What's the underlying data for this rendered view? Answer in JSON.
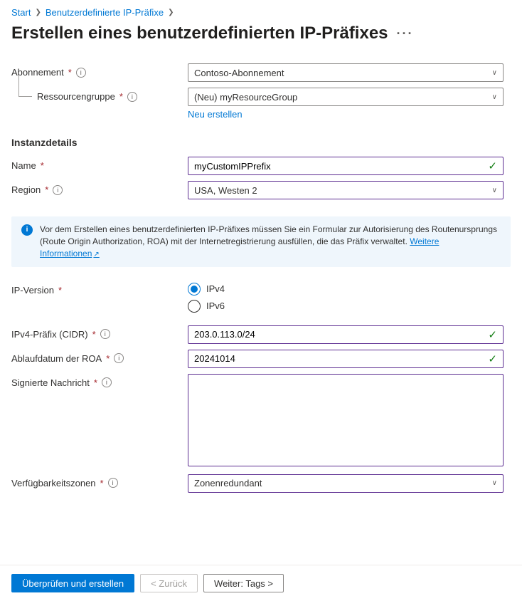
{
  "breadcrumb": {
    "items": [
      "Start",
      "Benutzerdefinierte IP-Präfixe"
    ]
  },
  "page": {
    "title": "Erstellen eines benutzerdefinierten IP-Präfixes"
  },
  "subscription": {
    "label": "Abonnement",
    "value": "Contoso-Abonnement"
  },
  "resourceGroup": {
    "label": "Ressourcengruppe",
    "value": "(Neu) myResourceGroup",
    "createNew": "Neu erstellen"
  },
  "instanceDetails": {
    "header": "Instanzdetails"
  },
  "name": {
    "label": "Name",
    "value": "myCustomIPPrefix"
  },
  "region": {
    "label": "Region",
    "value": "USA, Westen 2"
  },
  "infoBanner": {
    "text": "Vor dem Erstellen eines benutzerdefinierten IP-Präfixes müssen Sie ein Formular zur Autorisierung des Routenursprungs (Route Origin Authorization, ROA) mit der Internetregistrierung ausfüllen, die das Präfix verwaltet. ",
    "link": "Weitere Informationen"
  },
  "ipVersion": {
    "label": "IP-Version",
    "options": [
      "IPv4",
      "IPv6"
    ],
    "selected": "IPv4"
  },
  "ipv4Prefix": {
    "label": "IPv4-Präfix (CIDR)",
    "value": "203.0.113.0/24"
  },
  "roaExpiry": {
    "label": "Ablaufdatum der ROA",
    "value": "20241014"
  },
  "signedMessage": {
    "label": "Signierte Nachricht",
    "value": ""
  },
  "availabilityZones": {
    "label": "Verfügbarkeitszonen",
    "value": "Zonenredundant"
  },
  "footer": {
    "reviewCreate": "Überprüfen und erstellen",
    "back": "<  Zurück",
    "next": "Weiter: Tags >"
  }
}
